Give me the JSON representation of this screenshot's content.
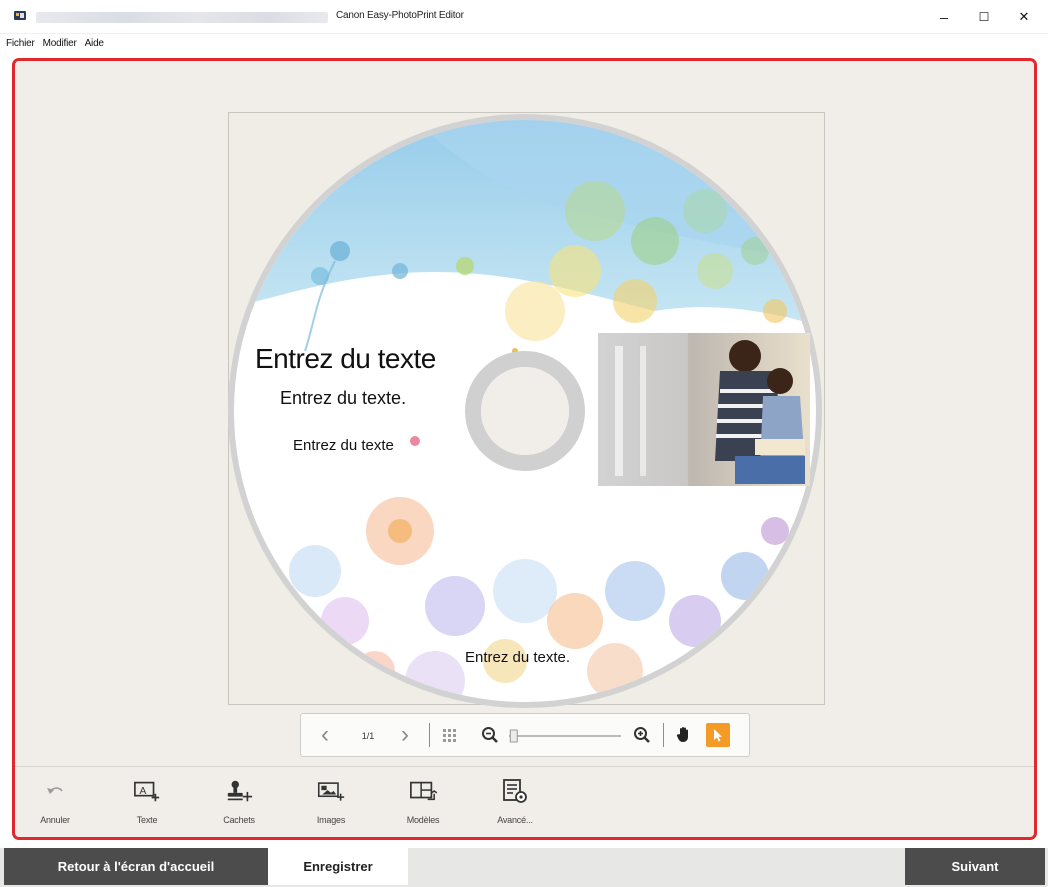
{
  "window": {
    "title": "Canon Easy-PhotoPrint Editor",
    "controls": {
      "minimize": "–",
      "maximize": "☐",
      "close": "✕"
    }
  },
  "menu": {
    "items": [
      "Fichier",
      "Modifier",
      "Aide"
    ]
  },
  "disc": {
    "texts": [
      "Entrez du texte",
      "Entrez du texte.",
      "Entrez du texte",
      "Entrez du texte."
    ]
  },
  "navbar": {
    "prev": "‹",
    "page": "1/1",
    "next": "›",
    "zoom_level": 0.03
  },
  "tools": [
    {
      "label": "Annuler",
      "icon": "undo-icon"
    },
    {
      "label": "Texte",
      "icon": "add-text-icon"
    },
    {
      "label": "Cachets",
      "icon": "stamp-icon"
    },
    {
      "label": "Images",
      "icon": "add-image-icon"
    },
    {
      "label": "Modèles",
      "icon": "layout-icon"
    },
    {
      "label": "Avancé...",
      "icon": "advanced-settings-icon"
    }
  ],
  "footer": {
    "home": "Retour à l'écran d'accueil",
    "save": "Enregistrer",
    "next": "Suivant"
  },
  "colors": {
    "highlight_border": "#e0282e",
    "select_tool_active": "#f39a27",
    "footer_dark": "#4c4c4c",
    "workspace_bg": "#f1eee9"
  }
}
